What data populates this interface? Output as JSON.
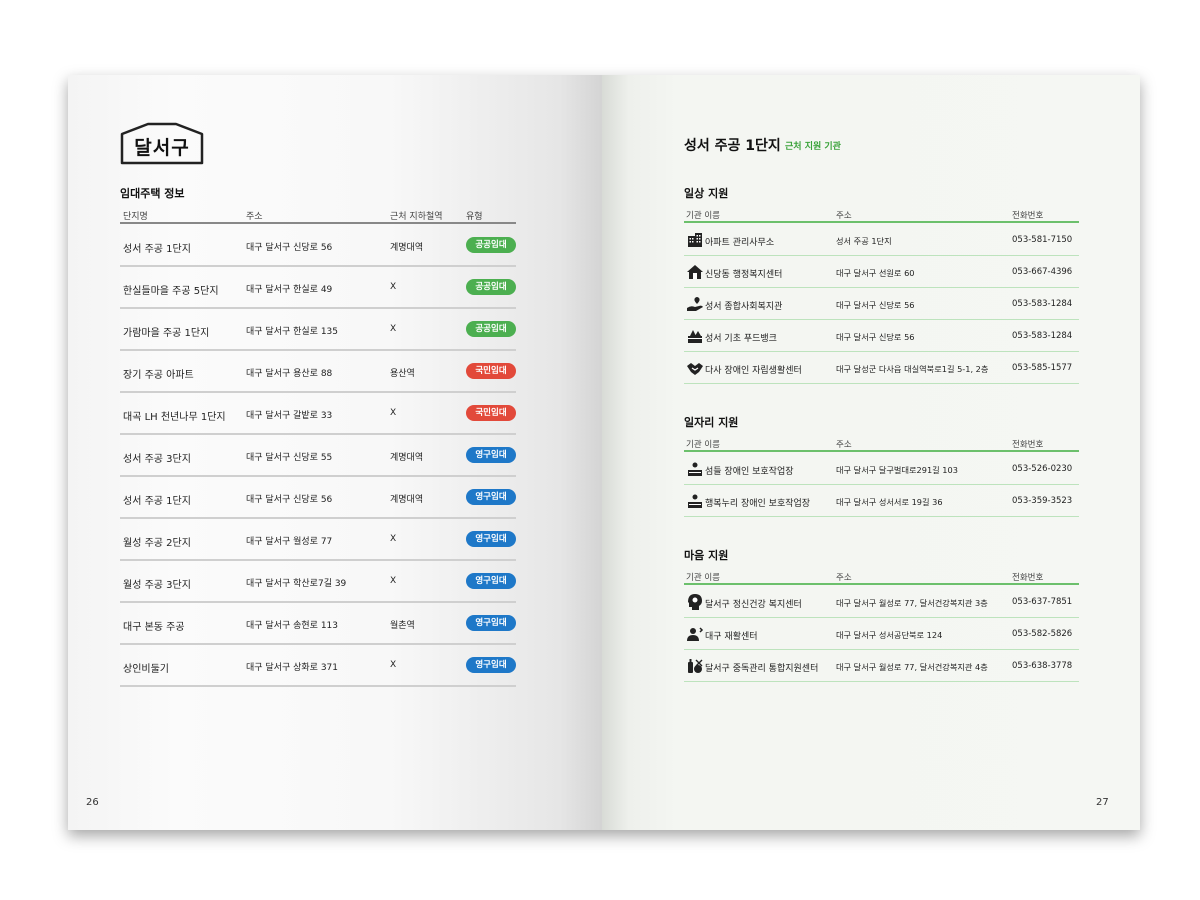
{
  "left_page": {
    "district_title": "달서구",
    "section_title": "임대주택 정보",
    "headers": {
      "name": "단지명",
      "address": "주소",
      "station": "근처 지하철역",
      "type": "유형"
    },
    "rows": [
      {
        "name": "성서 주공 1단지",
        "address": "대구 달서구 신당로 56",
        "station": "계명대역",
        "type": "공공임대",
        "color": "#4caf50"
      },
      {
        "name": "한실들마을 주공 5단지",
        "address": "대구 달서구 한실로 49",
        "station": "X",
        "type": "공공임대",
        "color": "#4caf50"
      },
      {
        "name": "가람마을 주공 1단지",
        "address": "대구 달서구 한실로 135",
        "station": "X",
        "type": "공공임대",
        "color": "#4caf50"
      },
      {
        "name": "장기 주공 아파트",
        "address": "대구 달서구 용산로 88",
        "station": "용산역",
        "type": "국민임대",
        "color": "#e2493a"
      },
      {
        "name": "대곡 LH 천년나무 1단지",
        "address": "대구 달서구 갈밭로 33",
        "station": "X",
        "type": "국민임대",
        "color": "#e2493a"
      },
      {
        "name": "성서 주공 3단지",
        "address": "대구 달서구 신당로 55",
        "station": "계명대역",
        "type": "영구임대",
        "color": "#1e78c8"
      },
      {
        "name": "성서 주공 1단지",
        "address": "대구 달서구 신당로 56",
        "station": "계명대역",
        "type": "영구임대",
        "color": "#1e78c8"
      },
      {
        "name": "월성 주공 2단지",
        "address": "대구 달서구 월성로 77",
        "station": "X",
        "type": "영구임대",
        "color": "#1e78c8"
      },
      {
        "name": "월성 주공 3단지",
        "address": "대구 달서구 학산로7길 39",
        "station": "X",
        "type": "영구임대",
        "color": "#1e78c8"
      },
      {
        "name": "대구 본동 주공",
        "address": "대구 달서구 송현로 113",
        "station": "월촌역",
        "type": "영구임대",
        "color": "#1e78c8"
      },
      {
        "name": "상인비둘기",
        "address": "대구 달서구 상화로 371",
        "station": "X",
        "type": "영구임대",
        "color": "#1e78c8"
      }
    ],
    "page_number": "26"
  },
  "right_page": {
    "title": "성서 주공 1단지",
    "subtitle": "근처 지원 기관",
    "accent_color": "#3aa33a",
    "headers": {
      "name": "기관 이름",
      "address": "주소",
      "tel": "전화번호"
    },
    "sections": [
      {
        "title": "일상 지원",
        "rows": [
          {
            "icon": "building-icon",
            "name": "아파트 관리사무소",
            "address": "성서 주공 1단지",
            "tel": "053-581-7150"
          },
          {
            "icon": "house-icon",
            "name": "신당동 행정복지센터",
            "address": "대구 달서구 선원로 60",
            "tel": "053-667-4396"
          },
          {
            "icon": "hand-care-icon",
            "name": "성서 종합사회복지관",
            "address": "대구 달서구 신당로 56",
            "tel": "053-583-1284"
          },
          {
            "icon": "food-bank-icon",
            "name": "성서 기초 푸드뱅크",
            "address": "대구 달서구 신당로 56",
            "tel": "053-583-1284"
          },
          {
            "icon": "handshake-icon",
            "name": "다사 장애인 자립생활센터",
            "address": "대구 달성군 다사읍 대실역북로1길 5-1, 2층",
            "tel": "053-585-1577"
          }
        ]
      },
      {
        "title": "일자리 지원",
        "rows": [
          {
            "icon": "workshop-icon",
            "name": "섬들 장애인 보호작업장",
            "address": "대구 달서구 달구벌대로291길 103",
            "tel": "053-526-0230"
          },
          {
            "icon": "workshop-icon",
            "name": "행복누리 장애인 보호작업장",
            "address": "대구 달서구 성서서로 19길 36",
            "tel": "053-359-3523"
          }
        ]
      },
      {
        "title": "마음 지원",
        "rows": [
          {
            "icon": "mental-health-icon",
            "name": "달서구 정신건강 복지센터",
            "address": "대구 달서구 월성로 77, 달서건강복지관 3층",
            "tel": "053-637-7851"
          },
          {
            "icon": "rehab-icon",
            "name": "대구 재활센터",
            "address": "대구 달서구 성서공단북로 124",
            "tel": "053-582-5826"
          },
          {
            "icon": "addiction-icon",
            "name": "달서구 중독관리 통합지원센터",
            "address": "대구 달서구 월성로 77, 달서건강복지관 4층",
            "tel": "053-638-3778"
          }
        ]
      }
    ],
    "page_number": "27"
  }
}
